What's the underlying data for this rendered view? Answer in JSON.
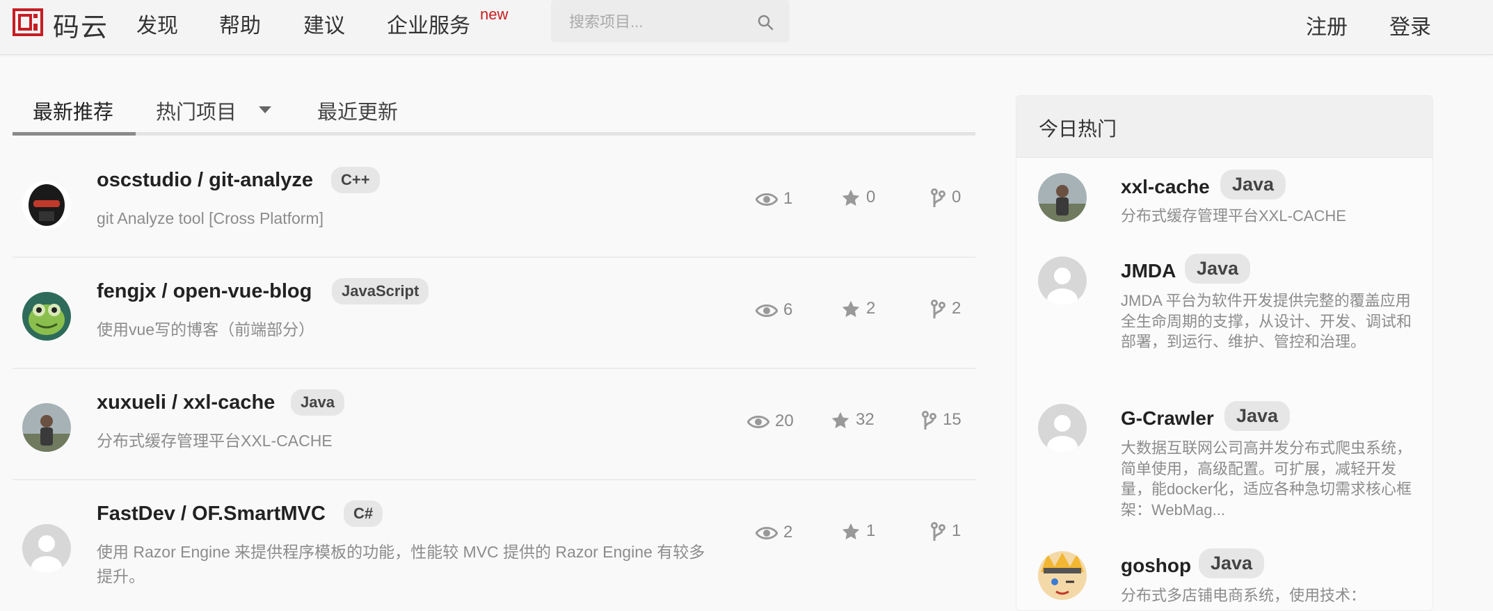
{
  "header": {
    "logo_text": "码云",
    "nav": [
      "发现",
      "帮助",
      "建议",
      "企业服务"
    ],
    "new_badge": "new",
    "search_placeholder": "搜索项目...",
    "register": "注册",
    "login": "登录",
    "brand_color": "#c71d23"
  },
  "tabs": [
    {
      "label": "最新推荐",
      "active": true
    },
    {
      "label": "热门项目",
      "has_dropdown": true
    },
    {
      "label": "最近更新"
    }
  ],
  "projects": [
    {
      "name": "oscstudio / git-analyze",
      "lang": "C++",
      "desc": "git Analyze tool [Cross Platform]",
      "views": "1",
      "stars": "0",
      "forks": "0",
      "avatar": "robot-avatar"
    },
    {
      "name": "fengjx / open-vue-blog",
      "lang": "JavaScript",
      "desc": "使用vue写的博客（前端部分）",
      "views": "6",
      "stars": "2",
      "forks": "2",
      "avatar": "frog-avatar"
    },
    {
      "name": "xuxueli / xxl-cache",
      "lang": "Java",
      "desc": "分布式缓存管理平台XXL-CACHE",
      "views": "20",
      "stars": "32",
      "forks": "15",
      "avatar": "photo-avatar"
    },
    {
      "name": "FastDev / OF.SmartMVC",
      "lang": "C#",
      "desc": "使用 Razor Engine 来提供程序模板的功能，性能较 MVC 提供的 Razor Engine 有较多提升。",
      "views": "2",
      "stars": "1",
      "forks": "1",
      "avatar": "default-avatar"
    }
  ],
  "sidebar": {
    "title": "今日热门",
    "items": [
      {
        "name": "xxl-cache",
        "lang": "Java",
        "desc": "分布式缓存管理平台XXL-CACHE",
        "avatar": "photo-avatar"
      },
      {
        "name": "JMDA",
        "lang": "Java",
        "desc": "JMDA 平台为软件开发提供完整的覆盖应用全生命周期的支撑，从设计、开发、调试和部署，到运行、维护、管控和治理。",
        "avatar": "default-avatar"
      },
      {
        "name": "G-Crawler",
        "lang": "Java",
        "desc": "大数据互联网公司高并发分布式爬虫系统，简单使用，高级配置。可扩展，减轻开发量，能docker化，适应各种急切需求核心框架：WebMag...",
        "avatar": "default-avatar"
      },
      {
        "name": "goshop",
        "lang": "Java",
        "desc": "分布式多店铺电商系统，使用技术：",
        "avatar": "anime-avatar"
      }
    ]
  }
}
